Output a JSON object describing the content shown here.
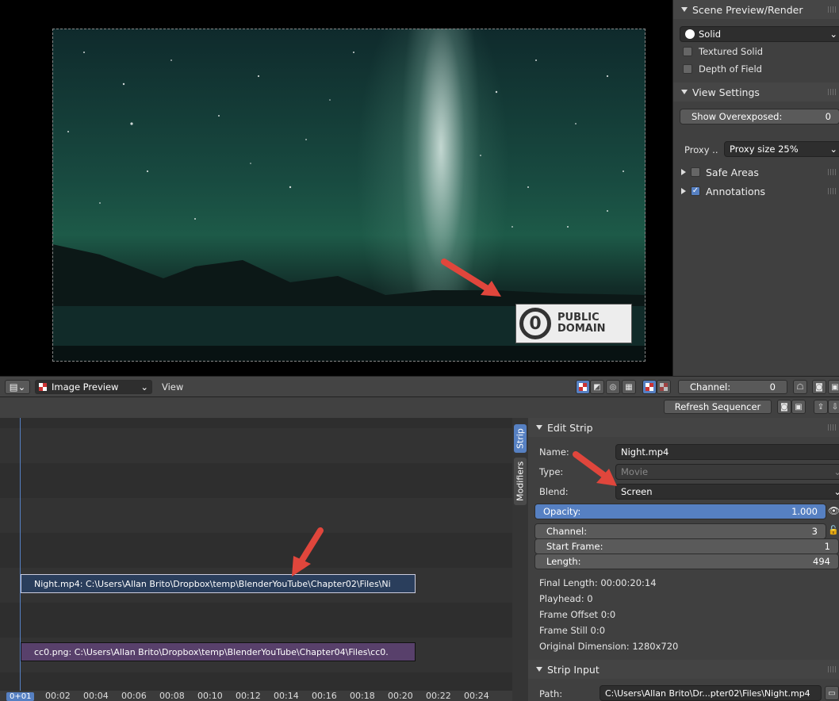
{
  "colors": {
    "accent": "#5680c2",
    "panel": "#404040",
    "strip_movie": "#2c3e5a",
    "strip_image": "#5a3f6a",
    "arrow": "#e0463c"
  },
  "preview": {
    "logo_line1": "PUBLIC",
    "logo_line2": "DOMAIN",
    "logo_symbol": "0"
  },
  "side_panel": {
    "scene_title": "Scene Preview/Render",
    "shading_value": "Solid",
    "textured_solid": "Textured Solid",
    "depth_of_field": "Depth of Field",
    "view_title": "View Settings",
    "show_overexposed_label": "Show Overexposed:",
    "show_overexposed_value": "0",
    "proxy_label": "Proxy ..",
    "proxy_value": "Proxy size 25%",
    "safe_areas": "Safe Areas",
    "annotations": "Annotations",
    "annotations_checked": true
  },
  "preview_header": {
    "mode_value": "Image Preview",
    "view_menu": "View",
    "channel_label": "Channel:",
    "channel_value": "0"
  },
  "seq_header": {
    "refresh_label": "Refresh Sequencer"
  },
  "strips": [
    {
      "label": "Night.mp4: C:\\Users\\Allan Brito\\Dropbox\\temp\\BlenderYouTube\\Chapter02\\Files\\Ni"
    },
    {
      "label": "cc0.png: C:\\Users\\Allan Brito\\Dropbox\\temp\\BlenderYouTube\\Chapter04\\Files\\cc0."
    }
  ],
  "timeline": {
    "current_frame": "0+01",
    "ticks": [
      "00:02",
      "00:04",
      "00:06",
      "00:08",
      "00:10",
      "00:12",
      "00:14",
      "00:16",
      "00:18",
      "00:20",
      "00:22",
      "00:24"
    ]
  },
  "tabs": {
    "strip": "Strip",
    "modifiers": "Modifiers"
  },
  "edit_strip": {
    "title": "Edit Strip",
    "name_label": "Name:",
    "name_value": "Night.mp4",
    "type_label": "Type:",
    "type_value": "Movie",
    "blend_label": "Blend:",
    "blend_value": "Screen",
    "opacity_label": "Opacity:",
    "opacity_value": "1.000",
    "channel_label": "Channel:",
    "channel_value": "3",
    "start_label": "Start Frame:",
    "start_value": "1",
    "length_label": "Length:",
    "length_value": "494",
    "final_length": "Final Length:  00:00:20:14",
    "playhead": "Playhead:  0",
    "frame_offset": "Frame Offset 0:0",
    "frame_still": "Frame Still 0:0",
    "original_dimension": "Original Dimension:  1280x720"
  },
  "strip_input": {
    "title": "Strip Input",
    "path_label": "Path:",
    "path_value": "C:\\Users\\Allan Brito\\Dr...pter02\\Files\\Night.mp4"
  }
}
